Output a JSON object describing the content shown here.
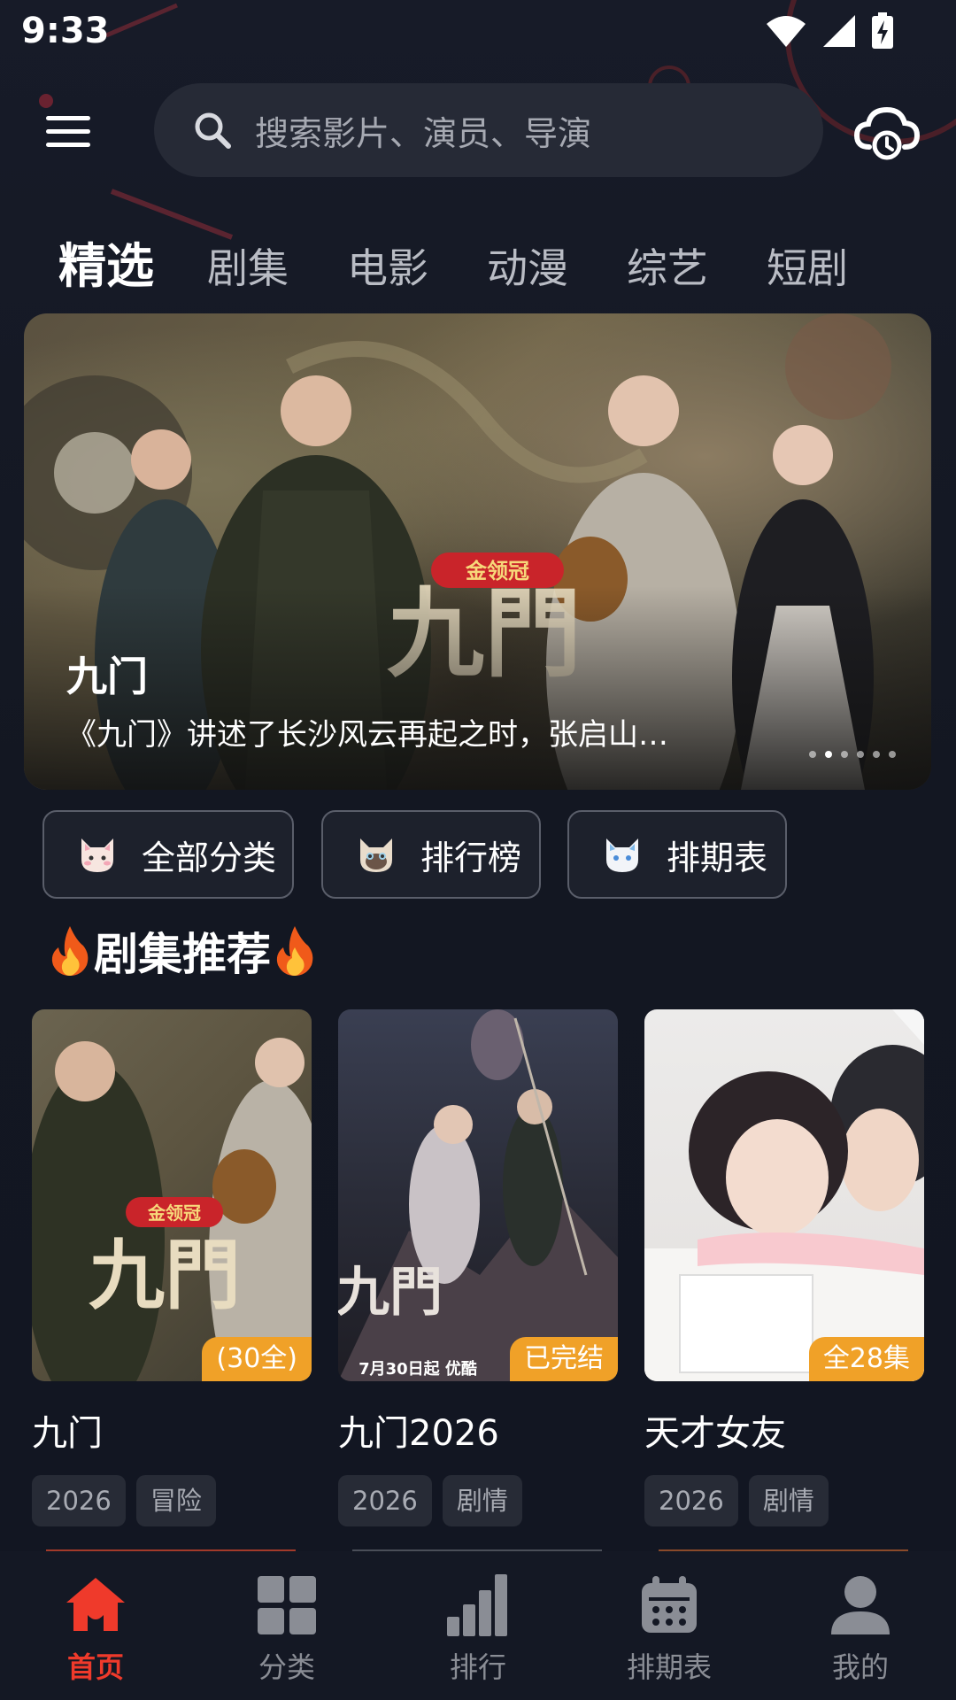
{
  "status_bar": {
    "time": "9:33"
  },
  "search": {
    "placeholder": "搜索影片、演员、导演"
  },
  "tabs": [
    {
      "label": "精选",
      "active": true
    },
    {
      "label": "剧集"
    },
    {
      "label": "电影"
    },
    {
      "label": "动漫"
    },
    {
      "label": "综艺"
    },
    {
      "label": "短剧"
    }
  ],
  "banner": {
    "title": "九门",
    "description": "《九门》讲述了长沙风云再起之时，张启山…",
    "logo_text": "金领冠",
    "art_text": "九門",
    "page_count": 6,
    "active_index": 1
  },
  "quick_links": [
    {
      "label": "全部分类",
      "icon": "cat-icon"
    },
    {
      "label": "排行榜",
      "icon": "siamese-cat-icon"
    },
    {
      "label": "排期表",
      "icon": "white-cat-icon"
    }
  ],
  "section": {
    "title": "剧集推荐"
  },
  "cards": [
    {
      "title": "九门",
      "badge": "(30全)",
      "year": "2026",
      "genre": "冒险",
      "poster_text": "九門",
      "poster_logo": "金领冠"
    },
    {
      "title": "九门2026",
      "badge": "已完结",
      "year": "2026",
      "genre": "剧情",
      "poster_text": "九門",
      "poster_caption": "7月30日起 优酷"
    },
    {
      "title": "天才女友",
      "badge": "全28集",
      "year": "2026",
      "genre": "剧情"
    }
  ],
  "bottom_nav": [
    {
      "label": "首页",
      "icon": "home-icon",
      "active": true
    },
    {
      "label": "分类",
      "icon": "grid-icon"
    },
    {
      "label": "排行",
      "icon": "bar-chart-icon"
    },
    {
      "label": "排期表",
      "icon": "calendar-icon"
    },
    {
      "label": "我的",
      "icon": "user-icon"
    }
  ],
  "colors": {
    "background": "#141824",
    "accent": "#ef3a2b",
    "badge": "#f0a128",
    "search_bg": "#262a36",
    "tag_bg": "#272b36"
  }
}
